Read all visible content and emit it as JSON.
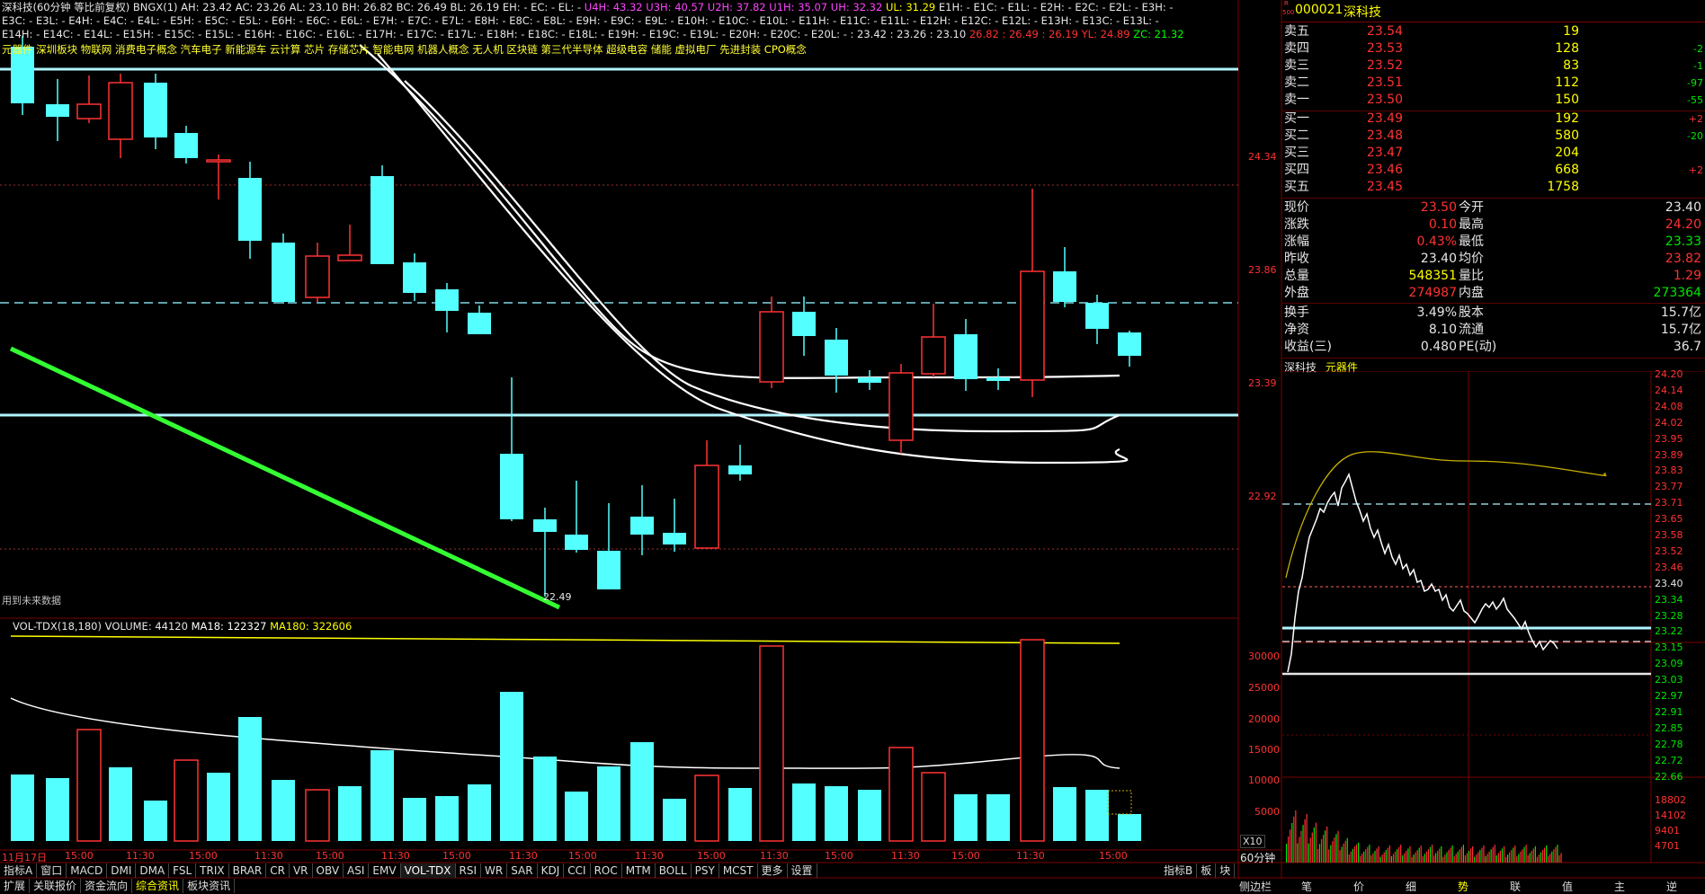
{
  "header": {
    "line1": [
      {
        "t": "深科技(60分钟 等比前复权)",
        "c": "#e6e6e6"
      },
      {
        "t": "  BNGX(1) ",
        "c": "#e6e6e6"
      },
      {
        "t": "AH: 23.42 ",
        "c": "#e6e6e6"
      },
      {
        "t": "AC: 23.26 ",
        "c": "#e6e6e6"
      },
      {
        "t": "AL: 23.10 ",
        "c": "#e6e6e6"
      },
      {
        "t": "BH: 26.82 ",
        "c": "#e6e6e6"
      },
      {
        "t": "BC: 26.49 ",
        "c": "#e6e6e6"
      },
      {
        "t": "BL: 26.19 ",
        "c": "#e6e6e6"
      },
      {
        "t": "EH: - ",
        "c": "#e6e6e6"
      },
      {
        "t": "EC: - ",
        "c": "#e6e6e6"
      },
      {
        "t": "EL: - ",
        "c": "#e6e6e6"
      },
      {
        "t": "U4H: 43.32 ",
        "c": "#ff44ff"
      },
      {
        "t": "U3H: 40.57 ",
        "c": "#ff44ff"
      },
      {
        "t": "U2H: 37.82 ",
        "c": "#ff44ff"
      },
      {
        "t": "U1H: 35.07 ",
        "c": "#ff44ff"
      },
      {
        "t": "UH: 32.32 ",
        "c": "#ff44ff"
      },
      {
        "t": "UL: 31.29 ",
        "c": "#ffff00"
      },
      {
        "t": "E1H: - ",
        "c": "#e6e6e6"
      },
      {
        "t": "E1C: - ",
        "c": "#e6e6e6"
      },
      {
        "t": "E1L: - ",
        "c": "#e6e6e6"
      },
      {
        "t": "E2H: - ",
        "c": "#e6e6e6"
      },
      {
        "t": "E2C: - ",
        "c": "#e6e6e6"
      },
      {
        "t": "E2L: - ",
        "c": "#e6e6e6"
      },
      {
        "t": "E3H: -",
        "c": "#e6e6e6"
      }
    ],
    "line2": "E3C: -  E3L: -  E4H: -  E4C: -  E4L: -  E5H: -  E5C: -  E5L: -  E6H: -  E6C: -  E6L: -  E7H: -  E7C: -  E7L: -  E8H: -  E8C: -  E8L: -  E9H: -  E9C: -  E9L: -  E10H: -  E10C: -  E10L: -  E11H: -  E11C: -  E11L: -  E12H: -  E12C: -  E12L: -  E13H: -  E13C: -  E13L: -",
    "line3": [
      {
        "t": "E14H: -  E14C: -  E14L: -  E15H: -  E15C: -  E15L: -  E16H: -  E16C: -  E16L: -  E17H: -  E17C: -  E17L: -  E18H: -  E18C: -  E18L: -  E19H: -  E19C: -  E19L: -  E20H: -  E20C: -  E20L: -  : 23.42  : 23.26  : 23.10  ",
        "c": "#e6e6e6"
      },
      {
        "t": "26.82  : 26.49  : 26.19  ",
        "c": "#ff3232"
      },
      {
        "t": "YL: 24.89  ",
        "c": "#ff3232"
      },
      {
        "t": "ZC: 21.32",
        "c": "#00ff00"
      }
    ],
    "line4": "元器件 深圳板块 物联网 消费电子概念 汽车电子 新能源车 云计算 芯片 存储芯片 智能电网 机器人概念 无人机 区块链 第三代半导体 超级电容 储能 虚拟电厂 先进封装 CPO概念",
    "future_note": "用到未来数据",
    "low_label": "22.49"
  },
  "price_axis": [
    "24.34",
    "23.86",
    "23.39",
    "22.92"
  ],
  "volume_header": [
    {
      "t": "VOL-TDX(18,180) ",
      "c": "#e6e6e6"
    },
    {
      "t": "VOLUME: 44120 ",
      "c": "#e6e6e6"
    },
    {
      "t": "MA18: 122327 ",
      "c": "#ffffff"
    },
    {
      "t": "MA180: 322606",
      "c": "#ffff00"
    }
  ],
  "volume_axis": [
    "30000",
    "25000",
    "20000",
    "15000",
    "10000",
    "5000"
  ],
  "volume_unit": "X10",
  "time_axis": [
    "11月17日",
    "15:00",
    "11:30",
    "15:00",
    "11:30",
    "15:00",
    "11:30",
    "15:00",
    "11:30",
    "15:00",
    "11:30",
    "15:00",
    "11:30",
    "15:00",
    "11:30",
    "15:00",
    "11:30",
    "15:00"
  ],
  "period": "60分钟",
  "bottom_tabs": [
    "指标A",
    "窗口",
    "MACD",
    "DMI",
    "DMA",
    "FSL",
    "TRIX",
    "BRAR",
    "CR",
    "VR",
    "OBV",
    "ASI",
    "EMV",
    "VOL-TDX",
    "RSI",
    "WR",
    "SAR",
    "KDJ",
    "CCI",
    "ROC",
    "MTM",
    "BOLL",
    "PSY",
    "MCST",
    "更多",
    "设置"
  ],
  "bottom_right_tabs": [
    "指标B",
    "板",
    "块"
  ],
  "status_tabs": [
    "扩展",
    "关联报价",
    "资金流向",
    "综合资讯",
    "板块资讯"
  ],
  "sidebar_label": "侧边栏",
  "right_tabs": [
    "笔",
    "价",
    "细",
    "势",
    "联",
    "值",
    "主",
    "逆"
  ],
  "stock": {
    "code": "000021",
    "name": "深科技",
    "badge_r": "R",
    "badge_500": "500"
  },
  "order_book": {
    "sell": [
      {
        "label": "卖五",
        "price": "23.54",
        "vol": "19",
        "chg": ""
      },
      {
        "label": "卖四",
        "price": "23.53",
        "vol": "128",
        "chg": "-2"
      },
      {
        "label": "卖三",
        "price": "23.52",
        "vol": "83",
        "chg": "-1"
      },
      {
        "label": "卖二",
        "price": "23.51",
        "vol": "112",
        "chg": "-97"
      },
      {
        "label": "卖一",
        "price": "23.50",
        "vol": "150",
        "chg": "-55"
      }
    ],
    "buy": [
      {
        "label": "买一",
        "price": "23.49",
        "vol": "192",
        "chg": "+2"
      },
      {
        "label": "买二",
        "price": "23.48",
        "vol": "580",
        "chg": "-20"
      },
      {
        "label": "买三",
        "price": "23.47",
        "vol": "204",
        "chg": ""
      },
      {
        "label": "买四",
        "price": "23.46",
        "vol": "668",
        "chg": "+2"
      },
      {
        "label": "买五",
        "price": "23.45",
        "vol": "1758",
        "chg": ""
      }
    ]
  },
  "quote": [
    {
      "l1": "现价",
      "v1": "23.50",
      "c1": "red",
      "l2": "今开",
      "v2": "23.40",
      "c2": "wht"
    },
    {
      "l1": "涨跌",
      "v1": "0.10",
      "c1": "red",
      "l2": "最高",
      "v2": "24.20",
      "c2": "red"
    },
    {
      "l1": "涨幅",
      "v1": "0.43%",
      "c1": "red",
      "l2": "最低",
      "v2": "23.33",
      "c2": "grn"
    },
    {
      "l1": "昨收",
      "v1": "23.40",
      "c1": "wht",
      "l2": "均价",
      "v2": "23.82",
      "c2": "red"
    },
    {
      "l1": "总量",
      "v1": "548351",
      "c1": "yel",
      "l2": "量比",
      "v2": "1.29",
      "c2": "red"
    },
    {
      "l1": "外盘",
      "v1": "274987",
      "c1": "red",
      "l2": "内盘",
      "v2": "273364",
      "c2": "grn"
    }
  ],
  "fundamentals": [
    {
      "l1": "换手",
      "v1": "3.49%",
      "l2": "股本",
      "v2": "15.7亿"
    },
    {
      "l1": "净资",
      "v1": "8.10",
      "l2": "流通",
      "v2": "15.7亿"
    },
    {
      "l1": "收益(三)",
      "v1": "0.480",
      "l2": "PE(动)",
      "v2": "36.7"
    }
  ],
  "mini": {
    "title": "深科技",
    "sector": "元器件",
    "axis": [
      "24.20",
      "24.14",
      "24.08",
      "24.02",
      "23.95",
      "23.89",
      "23.83",
      "23.77",
      "23.71",
      "23.65",
      "23.58",
      "23.52",
      "23.46",
      "23.40",
      "23.34",
      "23.28",
      "23.22",
      "23.15",
      "23.09",
      "23.03",
      "22.97",
      "22.91",
      "22.85",
      "22.78",
      "22.72",
      "22.66"
    ],
    "vol_axis": [
      "18802",
      "14102",
      "9401",
      "4701"
    ]
  },
  "colors": {
    "up": "#ff3232",
    "down": "#54ffff",
    "cyan_line": "#b0f5ff",
    "green_trend": "#33ff33"
  }
}
